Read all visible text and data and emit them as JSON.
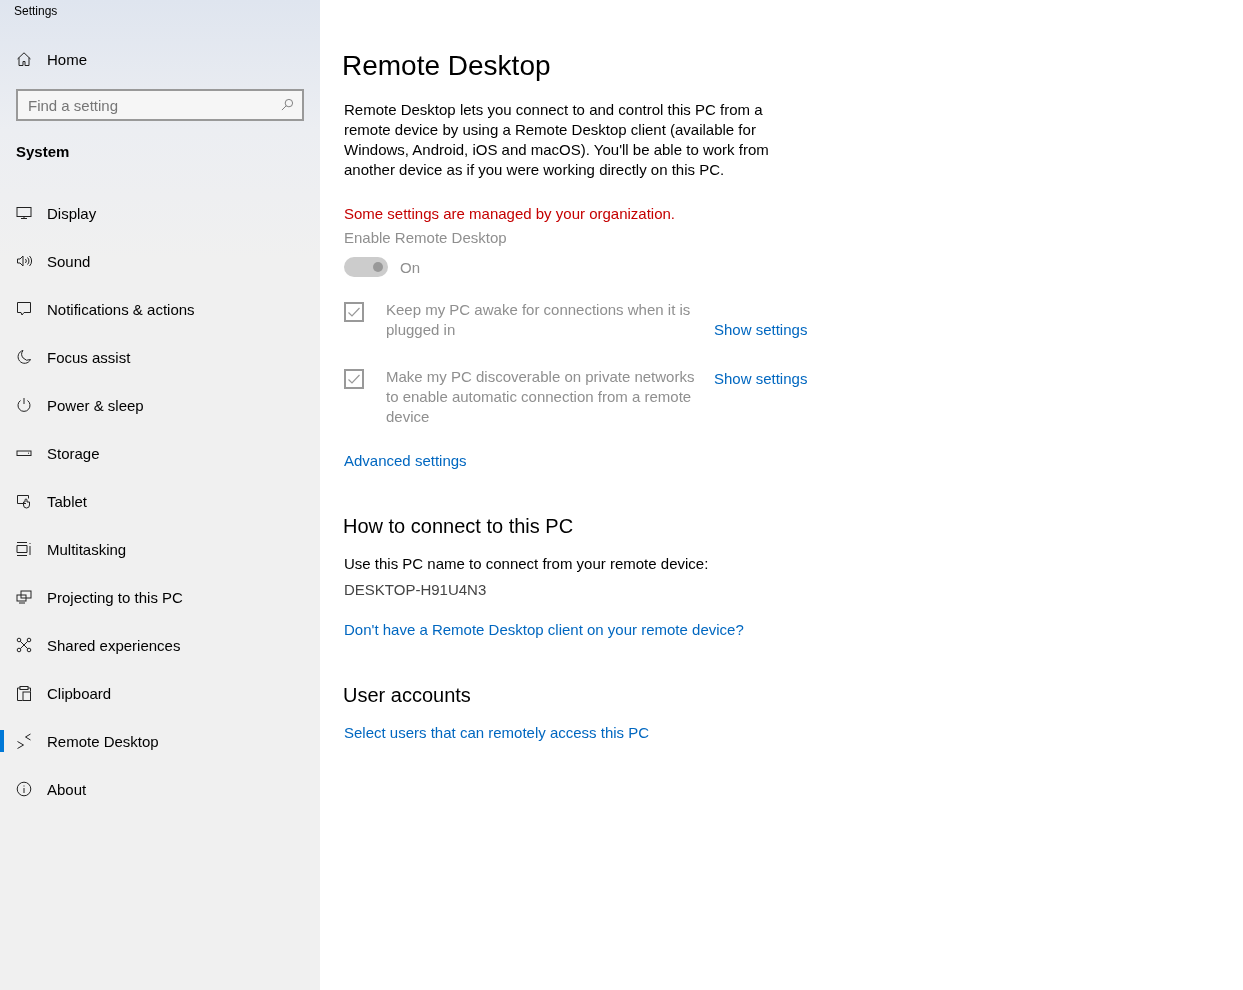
{
  "window": {
    "title": "Settings"
  },
  "sidebar": {
    "home": "Home",
    "search": {
      "placeholder": "Find a setting"
    },
    "section": "System",
    "items": [
      {
        "label": "Display",
        "selected": false
      },
      {
        "label": "Sound",
        "selected": false
      },
      {
        "label": "Notifications & actions",
        "selected": false
      },
      {
        "label": "Focus assist",
        "selected": false
      },
      {
        "label": "Power & sleep",
        "selected": false
      },
      {
        "label": "Storage",
        "selected": false
      },
      {
        "label": "Tablet",
        "selected": false
      },
      {
        "label": "Multitasking",
        "selected": false
      },
      {
        "label": "Projecting to this PC",
        "selected": false
      },
      {
        "label": "Shared experiences",
        "selected": false
      },
      {
        "label": "Clipboard",
        "selected": false
      },
      {
        "label": "Remote Desktop",
        "selected": true
      },
      {
        "label": "About",
        "selected": false
      }
    ]
  },
  "main": {
    "title": "Remote Desktop",
    "description": "Remote Desktop lets you connect to and control this PC from a remote device by using a Remote Desktop client (available for Windows, Android, iOS and macOS). You'll be able to work from another device as if you were working directly on this PC.",
    "warning": "Some settings are managed by your organization.",
    "toggle": {
      "label": "Enable Remote Desktop",
      "on": true,
      "disabled": true,
      "state_text": "On"
    },
    "options": [
      {
        "label": "Keep my PC awake for connections when it is plugged in",
        "checked": true,
        "disabled": true,
        "link": "Show settings"
      },
      {
        "label": "Make my PC discoverable on private networks to enable automatic connection from a remote device",
        "checked": true,
        "disabled": true,
        "link": "Show settings"
      }
    ],
    "advanced_link": "Advanced settings",
    "connect": {
      "heading": "How to connect to this PC",
      "text": "Use this PC name to connect from your remote device:",
      "pc_name": "DESKTOP-H91U4N3",
      "link": "Don't have a Remote Desktop client on your remote device?"
    },
    "accounts": {
      "heading": "User accounts",
      "link": "Select users that can remotely access this PC"
    }
  }
}
